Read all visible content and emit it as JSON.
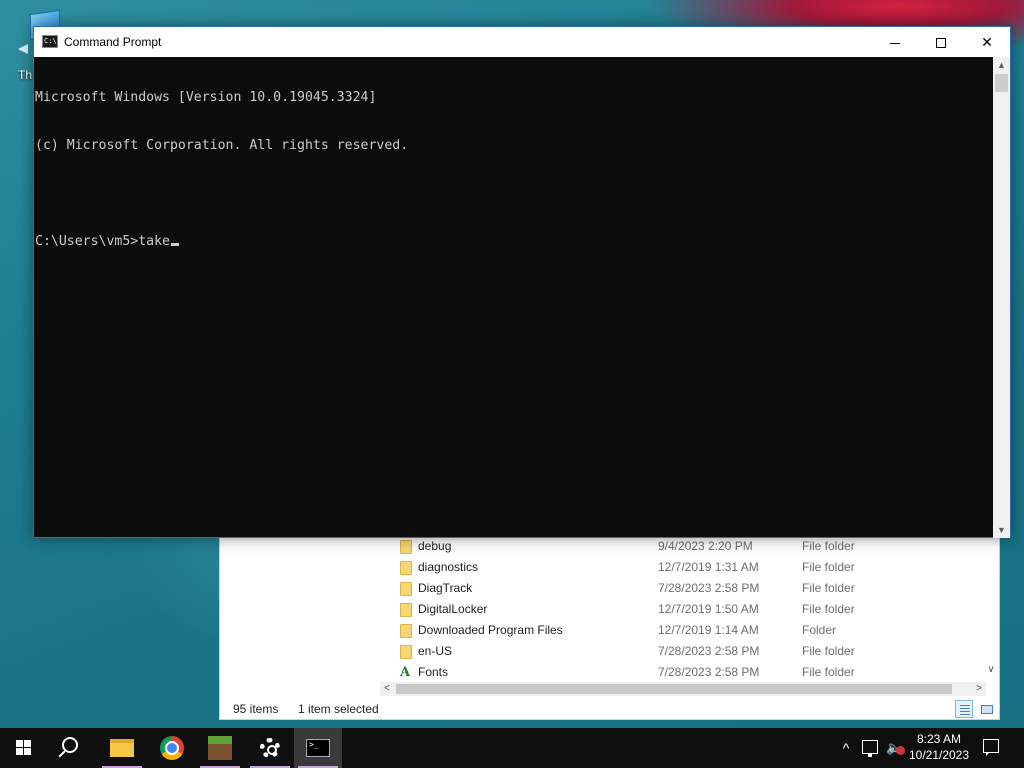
{
  "desktop": {
    "icon_label": "Th"
  },
  "cmd_window": {
    "title": "Command Prompt",
    "icon_text": "C:\\",
    "controls": {
      "minimize": "",
      "maximize": "",
      "close": "✕"
    },
    "lines": [
      "Microsoft Windows [Version 10.0.19045.3324]",
      "(c) Microsoft Corporation. All rights reserved.",
      "",
      "C:\\Users\\vm5>take"
    ],
    "scroll_up": "▲",
    "scroll_down": "▼"
  },
  "explorer": {
    "rows": [
      {
        "name": "debug",
        "date": "9/4/2023 2:20 PM",
        "type": "File folder",
        "icon": "folder-icon"
      },
      {
        "name": "diagnostics",
        "date": "12/7/2019 1:31 AM",
        "type": "File folder",
        "icon": "folder-icon"
      },
      {
        "name": "DiagTrack",
        "date": "7/28/2023 2:58 PM",
        "type": "File folder",
        "icon": "folder-icon"
      },
      {
        "name": "DigitalLocker",
        "date": "12/7/2019 1:50 AM",
        "type": "File folder",
        "icon": "folder-icon"
      },
      {
        "name": "Downloaded Program Files",
        "date": "12/7/2019 1:14 AM",
        "type": "Folder",
        "icon": "folder-icon"
      },
      {
        "name": "en-US",
        "date": "7/28/2023 2:58 PM",
        "type": "File folder",
        "icon": "folder-icon"
      },
      {
        "name": "Fonts",
        "date": "7/28/2023 2:58 PM",
        "type": "File folder",
        "icon": "fonts-folder-icon"
      }
    ],
    "fonts_glyph": "A",
    "status": {
      "item_count": "95 items",
      "selection": "1 item selected"
    },
    "hscroll_left": "<",
    "hscroll_right": ">",
    "vscroll_down": "∨"
  },
  "taskbar": {
    "apps": [
      {
        "name": "start",
        "icon": "windows-logo-icon"
      },
      {
        "name": "search",
        "icon": "search-icon"
      },
      {
        "name": "file-explorer",
        "icon": "folder-icon"
      },
      {
        "name": "chrome",
        "icon": "chrome-icon"
      },
      {
        "name": "minecraft",
        "icon": "minecraft-icon"
      },
      {
        "name": "settings",
        "icon": "gear-icon"
      },
      {
        "name": "command-prompt",
        "icon": "cmd-icon"
      }
    ],
    "tray": {
      "chevron": "^",
      "time": "8:23 AM",
      "date": "10/21/2023"
    }
  },
  "colors": {
    "console_bg": "#0c0c0c",
    "console_text": "#cccccc",
    "taskbar_bg": "#0f0f0f",
    "desktop_bg": "#1f7f92"
  }
}
